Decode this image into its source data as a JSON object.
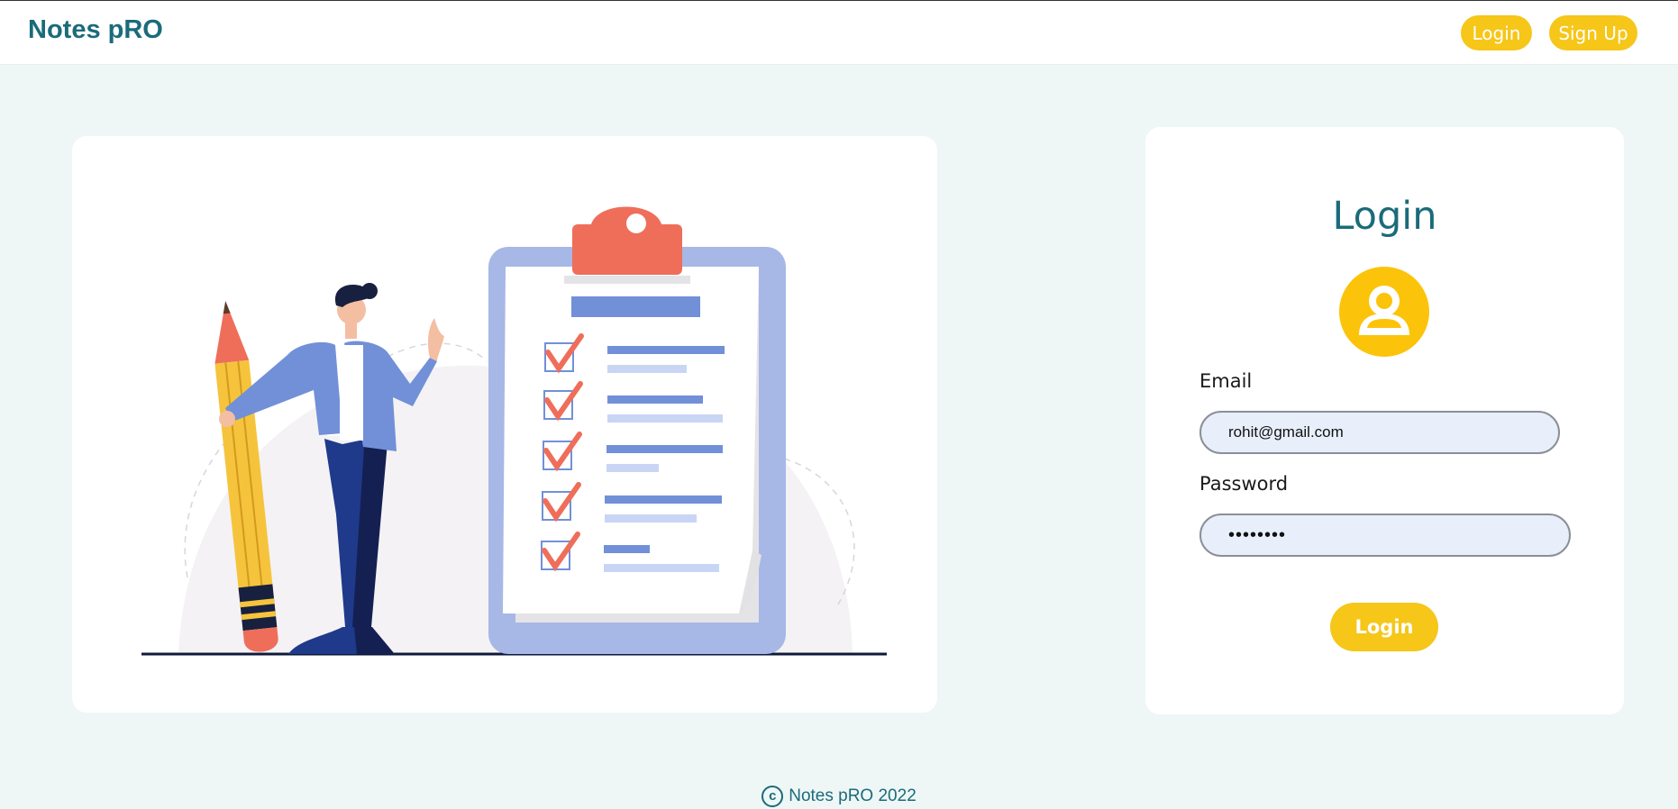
{
  "navbar": {
    "brand": "Notes pRO",
    "login_label": "Login",
    "signup_label": "Sign Up"
  },
  "login_form": {
    "title": "Login",
    "email_label": "Email",
    "email_value": "rohit@gmail.com",
    "password_label": "Password",
    "password_value": "rohit123",
    "submit_label": "Login"
  },
  "footer": {
    "copyright_symbol": "c",
    "text": "Notes pRO 2022"
  },
  "colors": {
    "brand": "#1b6b7a",
    "accent": "#f6c619",
    "avatar": "#fcc30b",
    "background": "#eef7f6",
    "input_bg": "#e8effb"
  }
}
